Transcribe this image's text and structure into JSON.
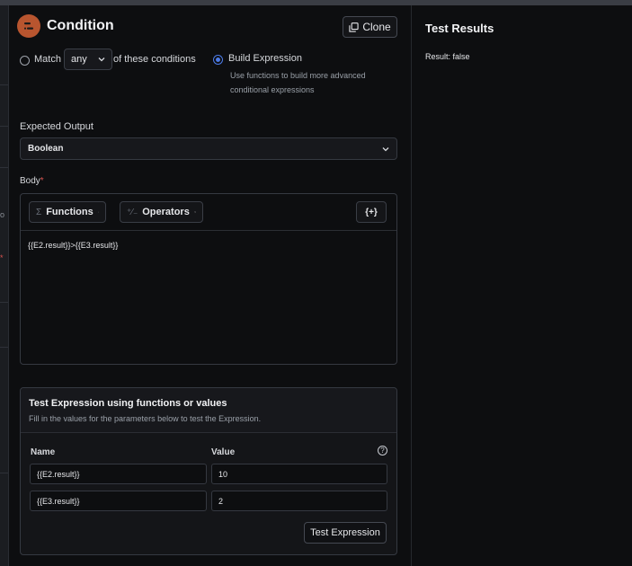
{
  "header": {
    "title": "Condition",
    "clone_label": "Clone"
  },
  "mode": {
    "match_label": "Match",
    "match_value": "any",
    "match_suffix": "of these conditions",
    "build_label": "Build Expression",
    "build_help_line1": "Use functions to build more advanced",
    "build_help_line2": "conditional expressions",
    "selected": "build"
  },
  "expected_output": {
    "label": "Expected Output",
    "value": "Boolean"
  },
  "body": {
    "label": "Body",
    "required_mark": "*",
    "functions_label": "Functions",
    "functions_icon": "Σ",
    "operators_label": "Operators",
    "operators_icon": "⁺⁄₋",
    "insert_label": "{+}",
    "expression": "{{E2.result}}>{{E3.result}}"
  },
  "test": {
    "title": "Test Expression using functions or values",
    "subtitle": "Fill in the values for the parameters below to test the Expression.",
    "col_name": "Name",
    "col_value": "Value",
    "help_glyph": "?",
    "rows": [
      {
        "name": "{{E2.result}}",
        "value": "10"
      },
      {
        "name": "{{E3.result}}",
        "value": "2"
      }
    ],
    "button_label": "Test Expression"
  },
  "results": {
    "title": "Test Results",
    "text": "Result: false"
  },
  "edge": {
    "glyph_a": "o",
    "glyph_b": "*"
  },
  "colors": {
    "accent": "#4c7be8",
    "icon_bg": "#b8552f",
    "required": "#d9534f"
  }
}
